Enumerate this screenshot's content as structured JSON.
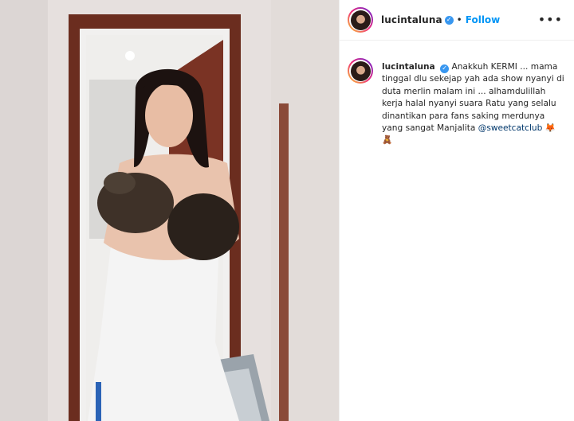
{
  "post": {
    "username": "lucintaluna",
    "separator": "•",
    "follow_label": "Follow",
    "more_label": "•••"
  },
  "caption": {
    "username": "lucintaluna",
    "text": "Anakkuh KERMI ... mama tinggal dlu sekejap yah ada show nyanyi di duta merlin malam ini ... alhamdulillah kerja halal nyanyi suara Ratu yang selalu dinantikan para fans saking merdunya yang sangat Manjalita",
    "mention": "@sweetcatclub",
    "emoji_1": "🦊",
    "emoji_2": "🧸"
  },
  "icons": {
    "verified": "verified-badge-icon",
    "more": "more-options-icon"
  },
  "colors": {
    "follow": "#0095f6",
    "verified": "#3897f0",
    "mention": "#00376b"
  }
}
